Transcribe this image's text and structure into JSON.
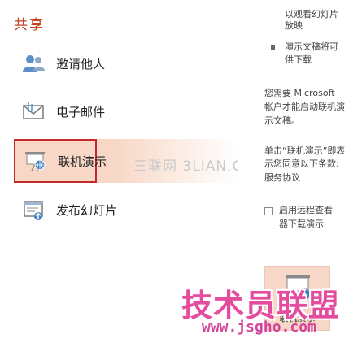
{
  "sidebar": {
    "title": "共享",
    "items": [
      {
        "label": "邀请他人",
        "icon": "people-icon"
      },
      {
        "label": "电子邮件",
        "icon": "email-icon"
      },
      {
        "label": "联机演示",
        "icon": "present-online-icon",
        "selected": true
      },
      {
        "label": "发布幻灯片",
        "icon": "publish-slides-icon"
      }
    ]
  },
  "panel": {
    "top_line1": "以观看幻灯片",
    "top_line2": "放映",
    "bullet2_line1": "演示文稿将可",
    "bullet2_line2": "供下载",
    "notice_line1": "您需要 Microsoft",
    "notice_line2": "帐户才能启动联机演",
    "notice_line3": "示文稿。",
    "terms_line1": "单击“联机演示”即表",
    "terms_line2": "示您同意以下条款:",
    "terms_link": "服务协议",
    "checkbox_line1": "启用远程查看",
    "checkbox_line2": "器下载演示",
    "present_button_label": "联机演示"
  },
  "watermarks": {
    "sanlian": "三联网 3LIAN.C",
    "jishu": "技术员联盟",
    "url": "www.jsgho.com"
  },
  "colors": {
    "title_accent": "#c4451f",
    "selected_fill": "#f8d7c6",
    "selected_border": "#c42a2a",
    "link": "#2b5797",
    "watermark_pink": "#e44d9d"
  }
}
